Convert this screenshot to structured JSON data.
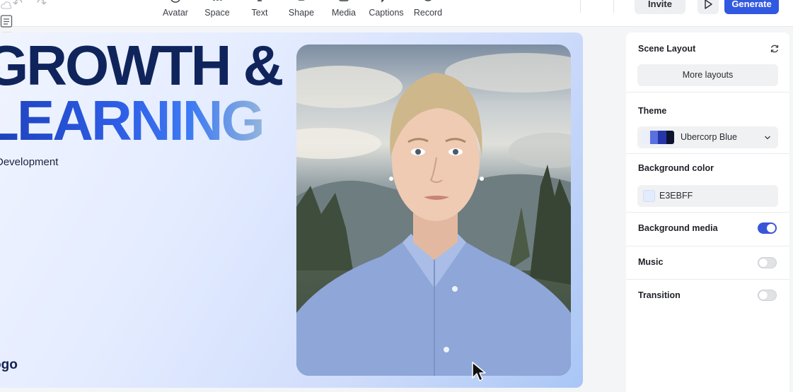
{
  "toolbar": {
    "tools": [
      {
        "label": "Avatar",
        "icon": "avatar-icon"
      },
      {
        "label": "Space",
        "icon": "space-icon"
      },
      {
        "label": "Text",
        "icon": "text-icon"
      },
      {
        "label": "Shape",
        "icon": "shape-icon"
      },
      {
        "label": "Media",
        "icon": "media-icon"
      },
      {
        "label": "Captions",
        "icon": "captions-icon"
      },
      {
        "label": "Record",
        "icon": "record-icon"
      }
    ],
    "invite_label": "Invite",
    "generate_label": "Generate",
    "accent_color": "#3158e0"
  },
  "slide": {
    "headline_line1": "GROWTH &",
    "headline_line2": "LEARNING",
    "subtitle": "Development",
    "logo_text": "ogo"
  },
  "panel": {
    "scene_layout_title": "Scene Layout",
    "more_layouts_label": "More layouts",
    "theme_title": "Theme",
    "theme_value": "Ubercorp Blue",
    "theme_swatches": [
      "#eceffa",
      "#5a6fe0",
      "#2636a8",
      "#0e1330"
    ],
    "bg_color_title": "Background color",
    "bg_color_value": "E3EBFF",
    "bg_color_hex": "#E3EBFF",
    "bg_media_title": "Background media",
    "bg_media_on": true,
    "music_title": "Music",
    "music_on": false,
    "transition_title": "Transition",
    "transition_on": false
  }
}
